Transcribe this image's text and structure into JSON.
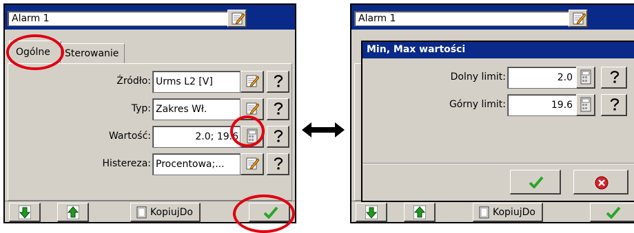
{
  "left": {
    "title": "Alarm 1",
    "tabs": [
      {
        "label": "Ogólne"
      },
      {
        "label": "Sterowanie"
      }
    ],
    "rows": [
      {
        "label": "Źródło:",
        "value": "Urms L2 [V]"
      },
      {
        "label": "Typ:",
        "value": "Zakres Wł."
      },
      {
        "label": "Wartość:",
        "value": "2.0; 19.6"
      },
      {
        "label": "Histereza:",
        "value": "Procentowa;..."
      }
    ],
    "bottom": {
      "copy_label": "KopiujDo"
    }
  },
  "right": {
    "title": "Alarm 1",
    "dialog": {
      "title": "Min, Max wartości",
      "rows": [
        {
          "label": "Dolny limit:",
          "value": "2.0"
        },
        {
          "label": "Górny limit:",
          "value": "19.6"
        }
      ]
    },
    "bottom": {
      "copy_label": "KopiujDo"
    }
  },
  "icons": {
    "edit": "pencil-notepad-icon",
    "help": "question-mark-icon",
    "calc": "calculator-icon",
    "ok": "green-checkmark-icon",
    "cancel": "red-x-icon",
    "down": "green-down-arrow-icon",
    "up": "green-up-arrow-icon",
    "exchange": "double-arrow-icon"
  },
  "colors": {
    "highlight": "#e00010",
    "titlebar": "#0a2a8a",
    "window": "#d4d0c8",
    "ok": "#2aa52a"
  }
}
